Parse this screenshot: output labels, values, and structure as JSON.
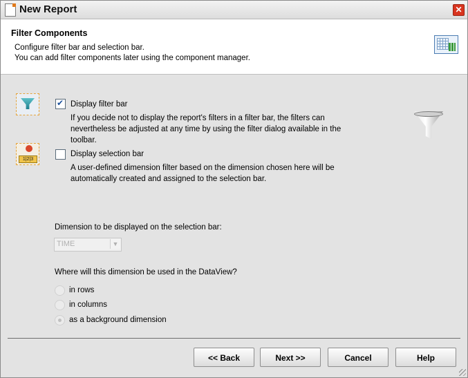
{
  "window": {
    "title": "New Report"
  },
  "header": {
    "title": "Filter Components",
    "line1": "Configure filter bar and selection bar.",
    "line2": "You can add filter components later using the component manager."
  },
  "filter_bar": {
    "label": "Display filter bar",
    "checked": true,
    "desc1": "If you decide not to display the report's filters in a filter bar, the filters can",
    "desc2": "nevertheless be adjusted at any time by using the filter dialog available in the",
    "desc3": "toolbar."
  },
  "selection_bar": {
    "label": "Display selection bar",
    "checked": false,
    "desc1": "A user-defined dimension filter based on the dimension chosen here will be",
    "desc2": "automatically created and assigned to the selection bar.",
    "icon_text": "1|2|3"
  },
  "dimension": {
    "label": "Dimension to be displayed on the selection bar:",
    "selected": "TIME"
  },
  "usage": {
    "question": "Where will this dimension be used in the DataView?",
    "options": [
      {
        "label": "in rows",
        "selected": false
      },
      {
        "label": "in columns",
        "selected": false
      },
      {
        "label": "as a background dimension",
        "selected": true
      }
    ]
  },
  "buttons": {
    "back": "<< Back",
    "next": "Next >>",
    "cancel": "Cancel",
    "help": "Help"
  },
  "icons": {
    "title": "report-icon",
    "close": "close-icon",
    "wizard": "chart-table-icon",
    "filter_side": "filter-bar-icon",
    "selection_side": "selection-bar-icon",
    "funnel": "funnel-icon"
  },
  "colors": {
    "close": "#d9341f",
    "accent": "#e5a33a"
  }
}
